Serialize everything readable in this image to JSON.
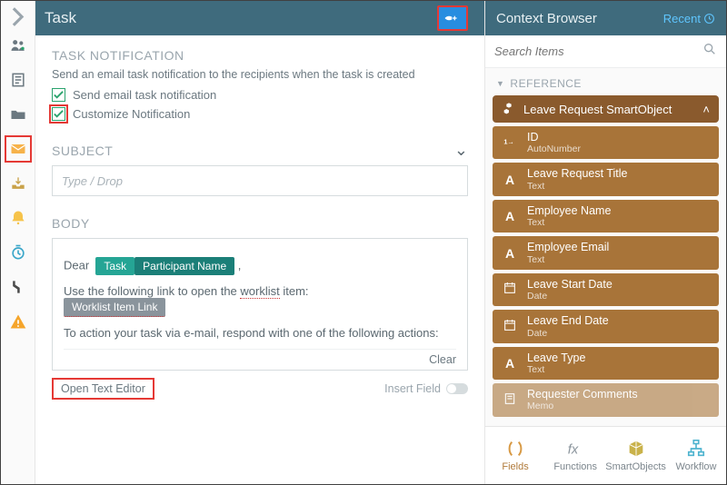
{
  "task": {
    "title": "Task",
    "notif": {
      "heading": "TASK NOTIFICATION",
      "hint": "Send an email task notification to the recipients when the task is created",
      "cb1": "Send email task notification",
      "cb2": "Customize Notification"
    },
    "subject": {
      "heading": "SUBJECT",
      "placeholder": "Type / Drop"
    },
    "body": {
      "heading": "BODY",
      "dear": "Dear",
      "tag_task": "Task",
      "tag_participant": "Participant Name",
      "line2a": "Use the following link to open the ",
      "line2b": "worklist",
      "line2c": " item:",
      "tag_worklist": "Worklist Item Link",
      "line3": "To action your task via e-mail, respond with one of the following actions:",
      "clear": "Clear",
      "open_editor": "Open Text Editor",
      "insert_field": "Insert Field"
    }
  },
  "ctx": {
    "title": "Context Browser",
    "recent": "Recent",
    "search_placeholder": "Search Items",
    "ref_heading": "REFERENCE",
    "so_title": "Leave Request SmartObject",
    "fields": [
      {
        "icon": "id",
        "name": "ID",
        "type": "AutoNumber"
      },
      {
        "icon": "A",
        "name": "Leave Request Title",
        "type": "Text"
      },
      {
        "icon": "A",
        "name": "Employee Name",
        "type": "Text"
      },
      {
        "icon": "A",
        "name": "Employee Email",
        "type": "Text"
      },
      {
        "icon": "cal",
        "name": "Leave Start Date",
        "type": "Date"
      },
      {
        "icon": "cal",
        "name": "Leave End Date",
        "type": "Date"
      },
      {
        "icon": "A",
        "name": "Leave Type",
        "type": "Text"
      },
      {
        "icon": "memo",
        "name": "Requester Comments",
        "type": "Memo"
      }
    ],
    "tabs": {
      "fields": "Fields",
      "functions": "Functions",
      "smartobjects": "SmartObjects",
      "workflow": "Workflow"
    }
  }
}
